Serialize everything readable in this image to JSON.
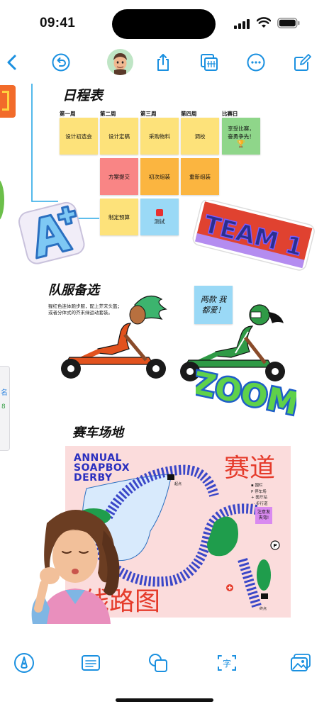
{
  "status_bar": {
    "time": "09:41"
  },
  "toolbar": {
    "accent": "#1a90e0"
  },
  "board": {
    "schedule": {
      "title": "日程表",
      "weeks": [
        "第一周",
        "第二周",
        "第三周",
        "第四周",
        "比赛日"
      ],
      "notes": {
        "w1_design_review": "设计初选会",
        "w2_design_final": "设计定稿",
        "w3_purchase": "采购物料",
        "w4_tune": "调校",
        "raceday": "享受比赛，奋勇争先！",
        "w2_submit": "方案提交",
        "w3_first_assembly": "初次组装",
        "w4_reassembly": "重新组装",
        "w2_budget": "制定预算",
        "w3_test": "测试"
      },
      "colors": {
        "yellow": "#fde27a",
        "red": "#f98585",
        "orange": "#fbb540",
        "green": "#8fd68a",
        "blue": "#9ad9f6"
      }
    },
    "team_sticker": "TEAM 1",
    "uniform": {
      "title": "队服备选",
      "description_line1": "猩红色连体跑步服，配上芥末头盔；",
      "description_line2": "或者分体式的芥末绿运动套装。",
      "note": "两款 我都爱！"
    },
    "zoom_sticker": "ZOOM",
    "track": {
      "title": "赛车场地",
      "map_title_line1": "ANNUAL",
      "map_title_line2": "SOAPBOX",
      "map_title_line3": "DERBY",
      "map_heading": "赛道",
      "route_label": "线路图",
      "legend": [
        "▪ 围栏",
        "P 停车场",
        "+ 医疗站",
        "··· 步行道"
      ],
      "start_label": "起点",
      "finish_label": "终点",
      "caution_note": "注意发夹弯!"
    },
    "left_card_text": "名",
    "left_card_text2": "8"
  }
}
